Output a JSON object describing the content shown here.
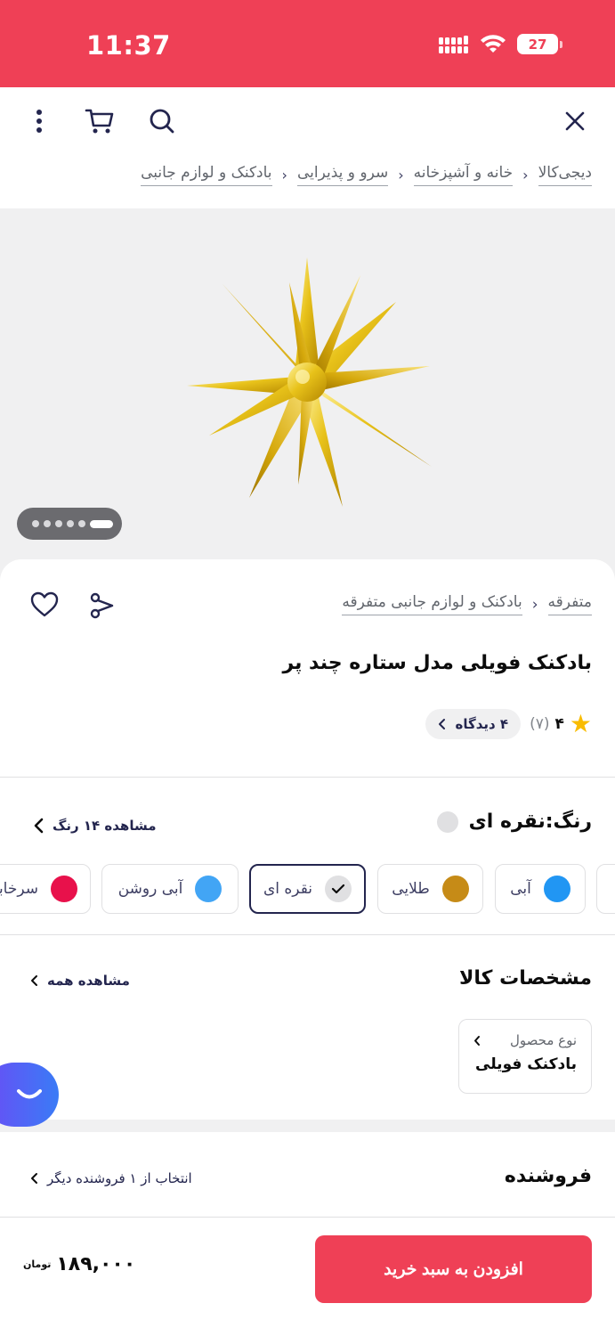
{
  "status": {
    "time": "11:37",
    "battery": "27"
  },
  "breadcrumb": [
    "دیجی‌کالا",
    "خانه و آشپزخانه",
    "سرو و پذیرایی",
    "بادکنک و لوازم جانبی"
  ],
  "category_crumb": [
    "متفرقه",
    "بادکنک و لوازم جانبی متفرقه"
  ],
  "product": {
    "title": "بادکنک فویلی مدل ستاره چند پر",
    "rating": "۴",
    "rating_count": "(۷)",
    "reviews": "۴ دیدگاه"
  },
  "color": {
    "heading": "رنگ:",
    "selected": "نقره ای",
    "see_all": "مشاهده ۱۴ رنگ",
    "options": [
      {
        "label": "آبی",
        "hex": "#2196f3"
      },
      {
        "label": "طلایی",
        "hex": "#c68b17"
      },
      {
        "label": "نقره ای",
        "hex": "#e0e0e2"
      },
      {
        "label": "آبی روشن",
        "hex": "#42a5f5"
      },
      {
        "label": "سرخابی",
        "hex": "#e8114b"
      }
    ]
  },
  "specs": {
    "title": "مشخصات کالا",
    "see_all": "مشاهده همه",
    "type_label": "نوع محصول",
    "type_value": "بادکنک فویلی"
  },
  "seller": {
    "title": "فروشنده",
    "other": "انتخاب از ۱ فروشنده دیگر"
  },
  "cart": {
    "button": "افزودن به سبد خرید",
    "price": "۱۸۹,۰۰۰",
    "currency": "تومان"
  },
  "colors": {
    "brand": "#ef4056",
    "text": "#23254e"
  }
}
